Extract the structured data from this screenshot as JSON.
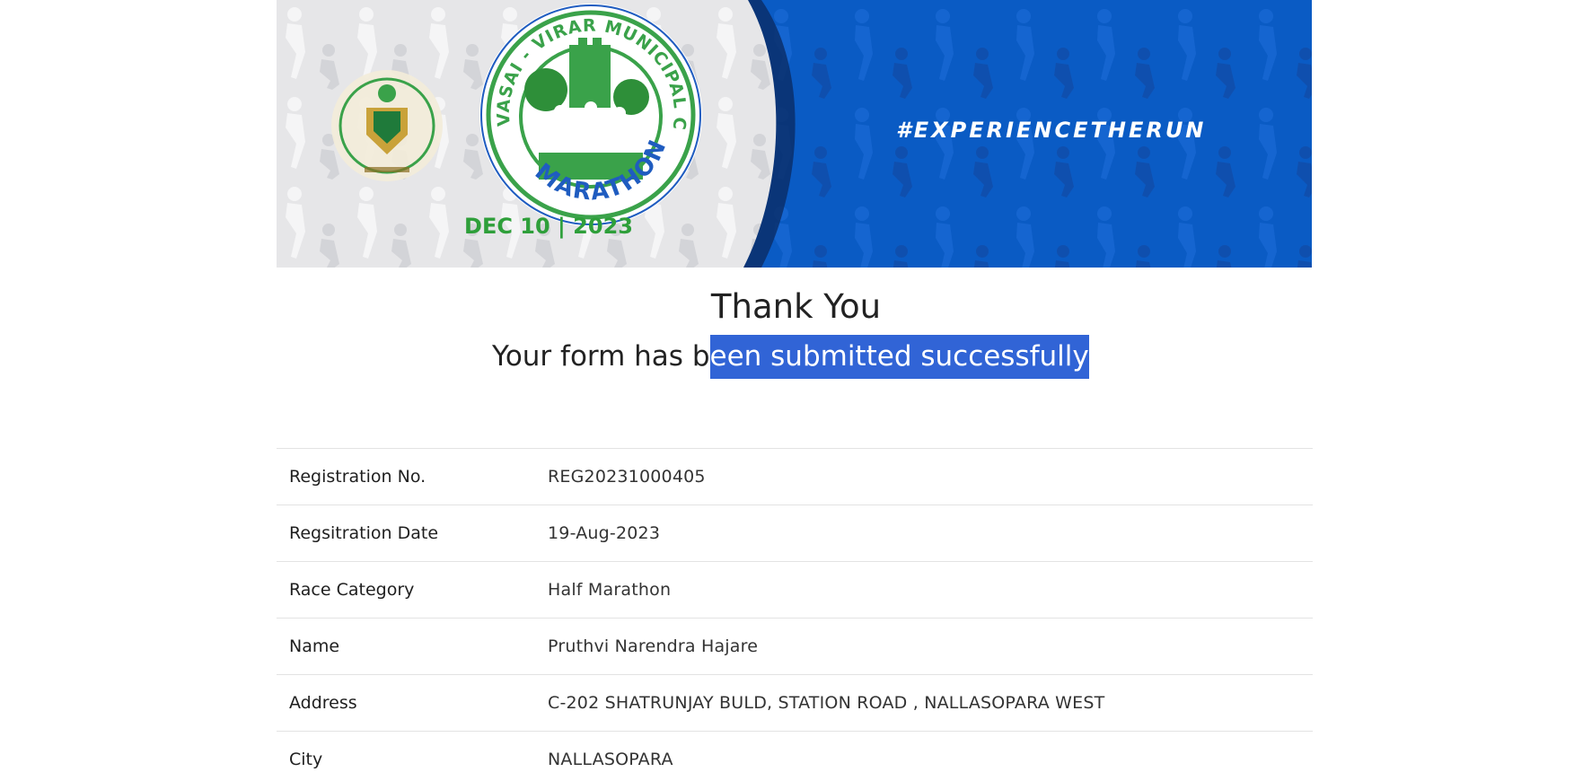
{
  "banner": {
    "hashtag": "#EXPERIENCETHERUN",
    "logo_text_arc": "VASAI - VIRAR MUNICIPAL CORPORATION",
    "logo_text_event": "MARATHON",
    "logo_date": "DEC 10 | 2023",
    "colors": {
      "banner_blue": "#0a5bc4",
      "logo_green": "#2e9f3a",
      "logo_blue": "#1f5cc0",
      "seal_gold": "#c9a23a"
    }
  },
  "confirmation": {
    "title": "Thank You",
    "subtitle_prefix": "Your form has b",
    "subtitle_selected": "een submitted successfully",
    "selection_color": "#3164d6"
  },
  "details": {
    "rows": [
      {
        "label": "Registration No.",
        "value": "REG20231000405"
      },
      {
        "label": "Regsitration Date",
        "value": "19-Aug-2023"
      },
      {
        "label": "Race Category",
        "value": "Half Marathon"
      },
      {
        "label": "Name",
        "value": "Pruthvi Narendra Hajare"
      },
      {
        "label": "Address",
        "value": "C-202 SHATRUNJAY BULD, STATION ROAD , NALLASOPARA WEST"
      },
      {
        "label": "City",
        "value": "NALLASOPARA"
      }
    ]
  }
}
